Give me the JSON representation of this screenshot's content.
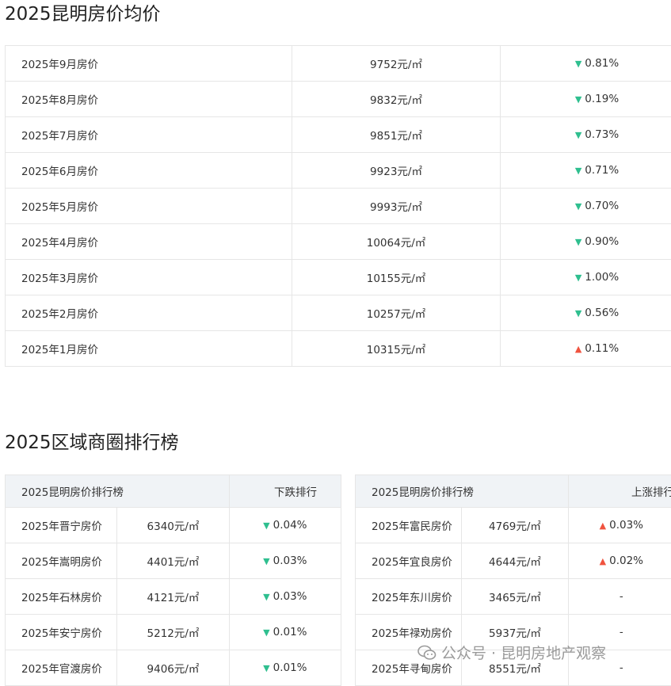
{
  "titles": {
    "avg_price": "2025昆明房价均价",
    "district_ranking": "2025区域商圈排行榜"
  },
  "monthly_prices": [
    {
      "month": "2025年9月房价",
      "price": "9752元/㎡",
      "trend": "down",
      "change": "0.81%"
    },
    {
      "month": "2025年8月房价",
      "price": "9832元/㎡",
      "trend": "down",
      "change": "0.19%"
    },
    {
      "month": "2025年7月房价",
      "price": "9851元/㎡",
      "trend": "down",
      "change": "0.73%"
    },
    {
      "month": "2025年6月房价",
      "price": "9923元/㎡",
      "trend": "down",
      "change": "0.71%"
    },
    {
      "month": "2025年5月房价",
      "price": "9993元/㎡",
      "trend": "down",
      "change": "0.70%"
    },
    {
      "month": "2025年4月房价",
      "price": "10064元/㎡",
      "trend": "down",
      "change": "0.90%"
    },
    {
      "month": "2025年3月房价",
      "price": "10155元/㎡",
      "trend": "down",
      "change": "1.00%"
    },
    {
      "month": "2025年2月房价",
      "price": "10257元/㎡",
      "trend": "down",
      "change": "0.56%"
    },
    {
      "month": "2025年1月房价",
      "price": "10315元/㎡",
      "trend": "up",
      "change": "0.11%"
    }
  ],
  "ranking_down": {
    "header_title": "2025昆明房价排行榜",
    "header_rank": "下跌排行",
    "rows": [
      {
        "name": "2025年晋宁房价",
        "price": "6340元/㎡",
        "trend": "down",
        "change": "0.04%"
      },
      {
        "name": "2025年嵩明房价",
        "price": "4401元/㎡",
        "trend": "down",
        "change": "0.03%"
      },
      {
        "name": "2025年石林房价",
        "price": "4121元/㎡",
        "trend": "down",
        "change": "0.03%"
      },
      {
        "name": "2025年安宁房价",
        "price": "5212元/㎡",
        "trend": "down",
        "change": "0.01%"
      },
      {
        "name": "2025年官渡房价",
        "price": "9406元/㎡",
        "trend": "down",
        "change": "0.01%"
      }
    ]
  },
  "ranking_up": {
    "header_title": "2025昆明房价排行榜",
    "header_rank": "上涨排行",
    "rows": [
      {
        "name": "2025年富民房价",
        "price": "4769元/㎡",
        "trend": "up",
        "change": "0.03%"
      },
      {
        "name": "2025年宜良房价",
        "price": "4644元/㎡",
        "trend": "up",
        "change": "0.02%"
      },
      {
        "name": "2025年东川房价",
        "price": "3465元/㎡",
        "trend": "none",
        "change": "-"
      },
      {
        "name": "2025年禄劝房价",
        "price": "5937元/㎡",
        "trend": "none",
        "change": "-"
      },
      {
        "name": "2025年寻甸房价",
        "price": "8551元/㎡",
        "trend": "none",
        "change": "-"
      }
    ]
  },
  "watermark": {
    "text": "公众号 · 昆明房地产观察",
    "icon": "wechat-icon"
  },
  "colors": {
    "down": "#2fbf8f",
    "up": "#f0533f",
    "header_bg": "#f0f3f6",
    "border": "#e6e6e6"
  }
}
